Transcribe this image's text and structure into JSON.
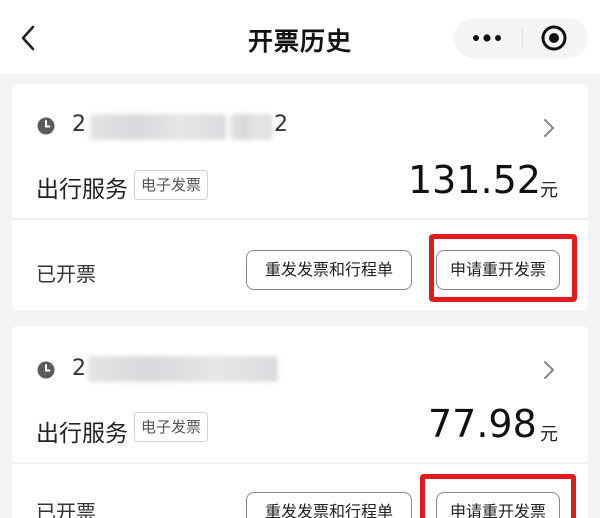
{
  "header": {
    "title": "开票历史",
    "back_icon": "chevron-left-icon",
    "more_icon": "more-dots-icon",
    "close_icon": "target-circle-icon"
  },
  "records": [
    {
      "date_prefix": "2",
      "date_suffix": "2",
      "service": "出行服务",
      "tag": "电子发票",
      "amount": "131.52",
      "unit": "元",
      "status": "已开票",
      "resend_label": "重发发票和行程单",
      "reissue_label": "申请重开发票"
    },
    {
      "date_prefix": "2",
      "date_suffix": "",
      "service": "出行服务",
      "tag": "电子发票",
      "amount": "77.98",
      "unit": "元",
      "status": "已开票",
      "resend_label": "重发发票和行程单",
      "reissue_label": "申请重开发票"
    }
  ],
  "colors": {
    "highlight": "#e41b1b",
    "background": "#f3f3f5",
    "card": "#ffffff"
  }
}
